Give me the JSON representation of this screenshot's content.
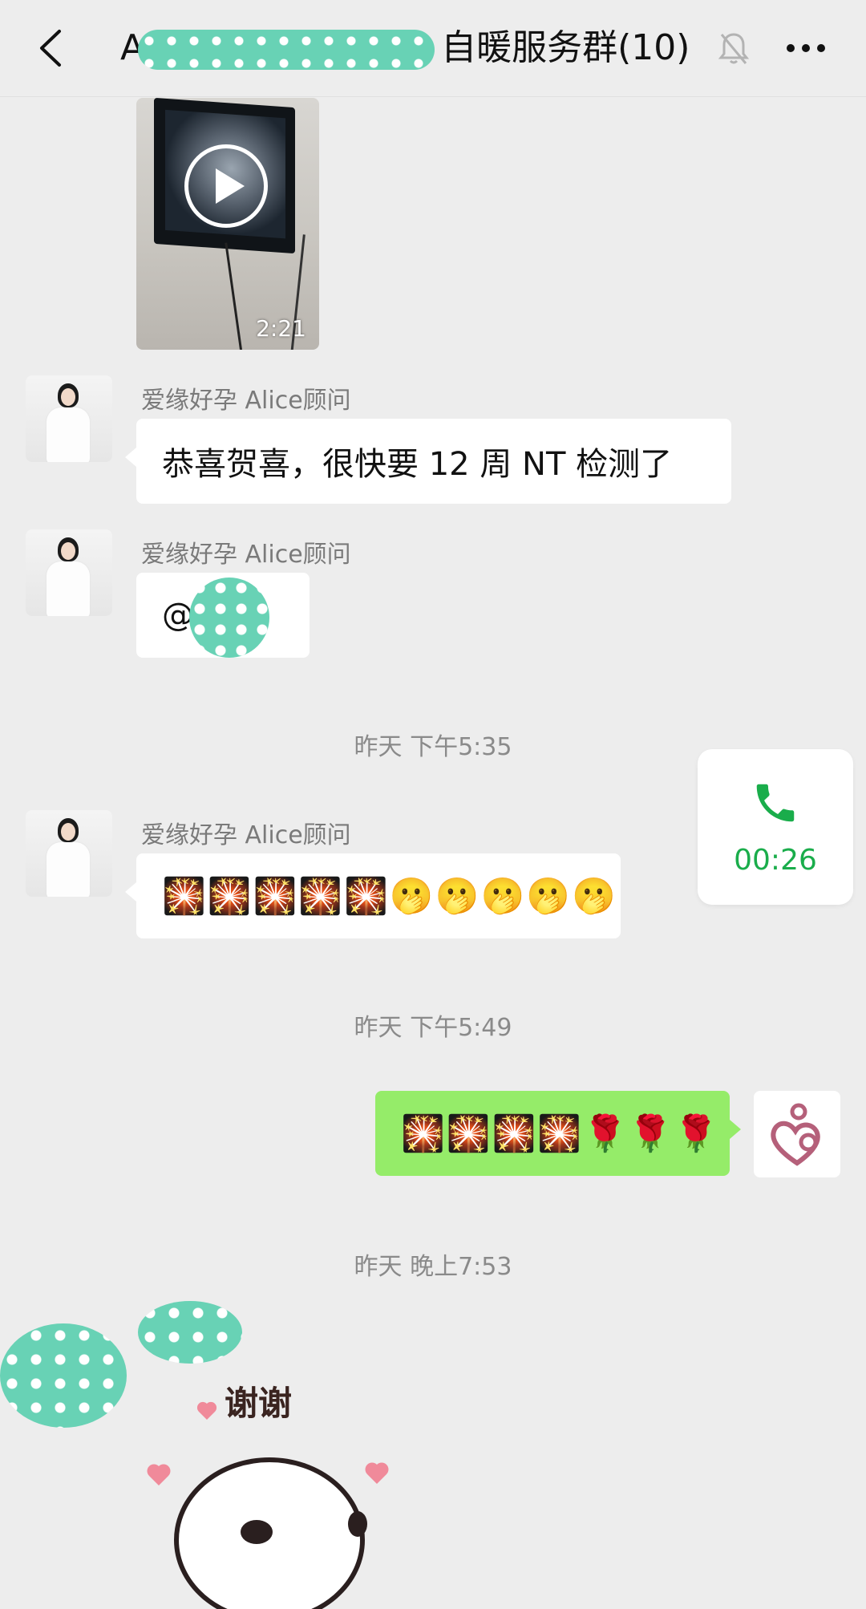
{
  "header": {
    "title_prefix": "A",
    "title_suffix": "自暖服务群(10)",
    "back_icon": "chevron-left-icon",
    "mute_icon": "bell-off-icon",
    "more_icon": "more-dots-icon"
  },
  "video": {
    "duration": "2:21"
  },
  "messages": [
    {
      "sender": "爱缘好孕 Alice顾问",
      "text": "恭喜贺喜，很快要 12 周 NT 检测了"
    },
    {
      "sender": "爱缘好孕 Alice顾问",
      "text": "@"
    },
    {
      "sender": "爱缘好孕 Alice顾问",
      "text": "🎇🎇🎇🎇🎇🫢🫢🫢🫢🫢"
    }
  ],
  "timestamps": [
    "昨天 下午5:35",
    "昨天 下午5:49",
    "昨天 晚上7:53"
  ],
  "call": {
    "duration": "00:26",
    "color": "#1aad4b"
  },
  "my_message": {
    "text": "🎇🎇🎇🎇🌹🌹🌹"
  },
  "sticker": {
    "caption": "谢谢"
  },
  "colors": {
    "background": "#ededed",
    "my_bubble": "#95ec69",
    "mask": "#68d2b5"
  }
}
